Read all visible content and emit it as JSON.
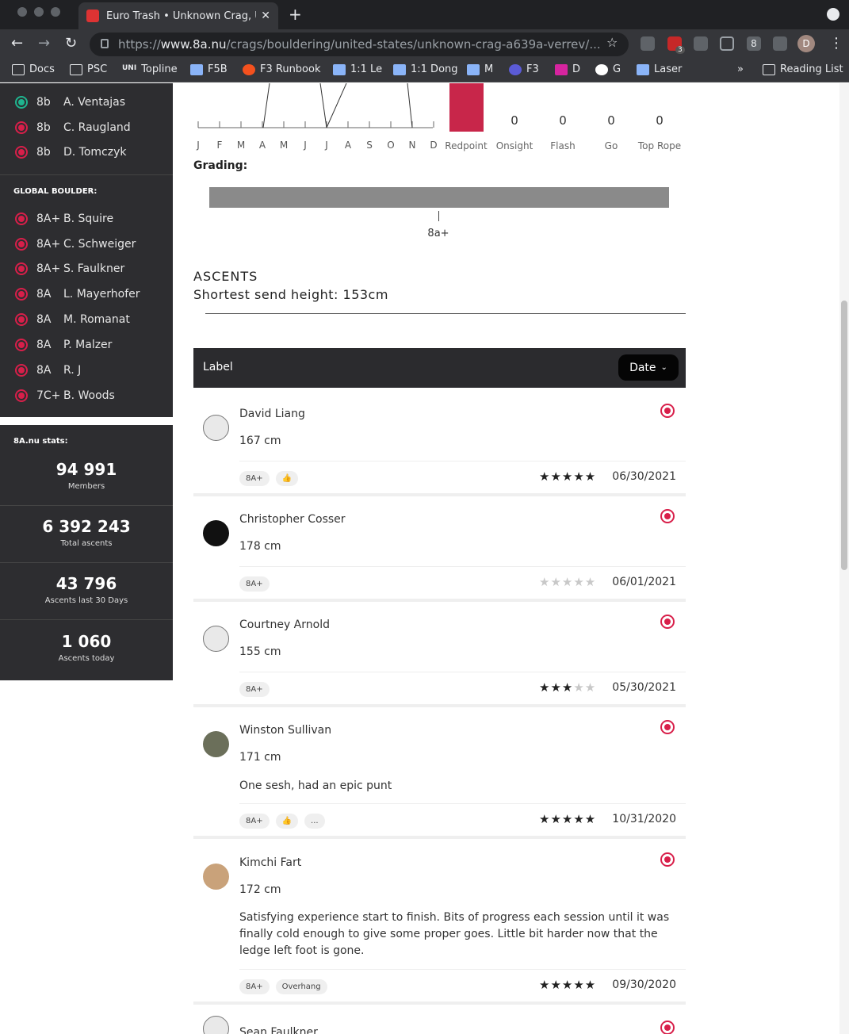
{
  "browser": {
    "tab_title": "Euro Trash • Unknown Crag, Ur",
    "url_prefix": "https://",
    "url_host": "www.8a.nu",
    "url_path": "/crags/bouldering/united-states/unknown-crag-a639a-verrev/...",
    "profile_initial": "D",
    "ext_badge": "3",
    "ext_count": "8",
    "bookmarks": [
      "Docs",
      "PSC",
      "Topline",
      "F5B",
      "F3 Runbook",
      "1:1 Le",
      "1:1 Dong",
      "M",
      "F3",
      "D",
      "G",
      "Laser"
    ],
    "bookmark_uni": "UNI",
    "reading_list": "Reading List",
    "more_chevron": "»"
  },
  "sidebar": {
    "top_list": [
      {
        "grade": "8b",
        "name": "A. Ventajas",
        "color": "green"
      },
      {
        "grade": "8b",
        "name": "C. Raugland",
        "color": "red"
      },
      {
        "grade": "8b",
        "name": "D. Tomczyk",
        "color": "red"
      }
    ],
    "global_heading": "GLOBAL BOULDER:",
    "global_list": [
      {
        "grade": "8A+",
        "name": "B. Squire"
      },
      {
        "grade": "8A+",
        "name": "C. Schweiger"
      },
      {
        "grade": "8A+",
        "name": "S. Faulkner"
      },
      {
        "grade": "8A",
        "name": "L. Mayerhofer"
      },
      {
        "grade": "8A",
        "name": "M. Romanat"
      },
      {
        "grade": "8A",
        "name": "P. Malzer"
      },
      {
        "grade": "8A",
        "name": "R. J"
      },
      {
        "grade": "7C+",
        "name": "B. Woods"
      }
    ],
    "stats_heading": "8A.nu stats:",
    "stats": [
      {
        "value": "94 991",
        "label": "Members"
      },
      {
        "value": "6 392 243",
        "label": "Total ascents"
      },
      {
        "value": "43 796",
        "label": "Ascents last 30 Days"
      },
      {
        "value": "1 060",
        "label": "Ascents today"
      }
    ]
  },
  "chart_data": {
    "type": "bar",
    "months": [
      "J",
      "F",
      "M",
      "A",
      "M",
      "J",
      "J",
      "A",
      "S",
      "O",
      "N",
      "D"
    ],
    "styles": [
      {
        "label": "Redpoint",
        "value": null,
        "color": "#c8264a"
      },
      {
        "label": "Onsight",
        "value": "0"
      },
      {
        "label": "Flash",
        "value": "0"
      },
      {
        "label": "Go",
        "value": "0"
      },
      {
        "label": "Top Rope",
        "value": "0"
      }
    ]
  },
  "grading": {
    "title": "Grading:",
    "grade_label": "8a+"
  },
  "ascents": {
    "title": "ASCENTS",
    "subtitle": "Shortest send height: 153cm",
    "table_label": "Label",
    "sort_label": "Date",
    "items": [
      {
        "name": "David Liang",
        "height": "167 cm",
        "comment": "",
        "tags": [
          "8A+",
          "👍"
        ],
        "rating": 5,
        "date": "06/30/2021",
        "avatar": "default"
      },
      {
        "name": "Christopher Cosser",
        "height": "178 cm",
        "comment": "",
        "tags": [
          "8A+"
        ],
        "rating": 0,
        "date": "06/01/2021",
        "avatar": "dark"
      },
      {
        "name": "Courtney Arnold",
        "height": "155 cm",
        "comment": "",
        "tags": [
          "8A+"
        ],
        "rating": 3,
        "date": "05/30/2021",
        "avatar": "default"
      },
      {
        "name": "Winston Sullivan",
        "height": "171 cm",
        "comment": "One sesh, had an epic punt",
        "tags": [
          "8A+",
          "👍",
          "..."
        ],
        "rating": 5,
        "date": "10/31/2020",
        "avatar": "green"
      },
      {
        "name": "Kimchi Fart",
        "height": "172 cm",
        "comment": "Satisfying experience start to finish. Bits of progress each session until it was finally cold enough to give some proper goes. Little bit harder now that the ledge left foot is gone.",
        "tags": [
          "8A+",
          "Overhang"
        ],
        "rating": 5,
        "date": "09/30/2020",
        "avatar": "orange"
      },
      {
        "name": "Sean Faulkner",
        "height": "",
        "comment": "",
        "tags": [],
        "rating": 0,
        "date": "",
        "avatar": "default"
      }
    ]
  },
  "colors": {
    "accent": "#d81f4a",
    "sidebar_bg": "#2d2d30",
    "green": "#1fb58f"
  }
}
